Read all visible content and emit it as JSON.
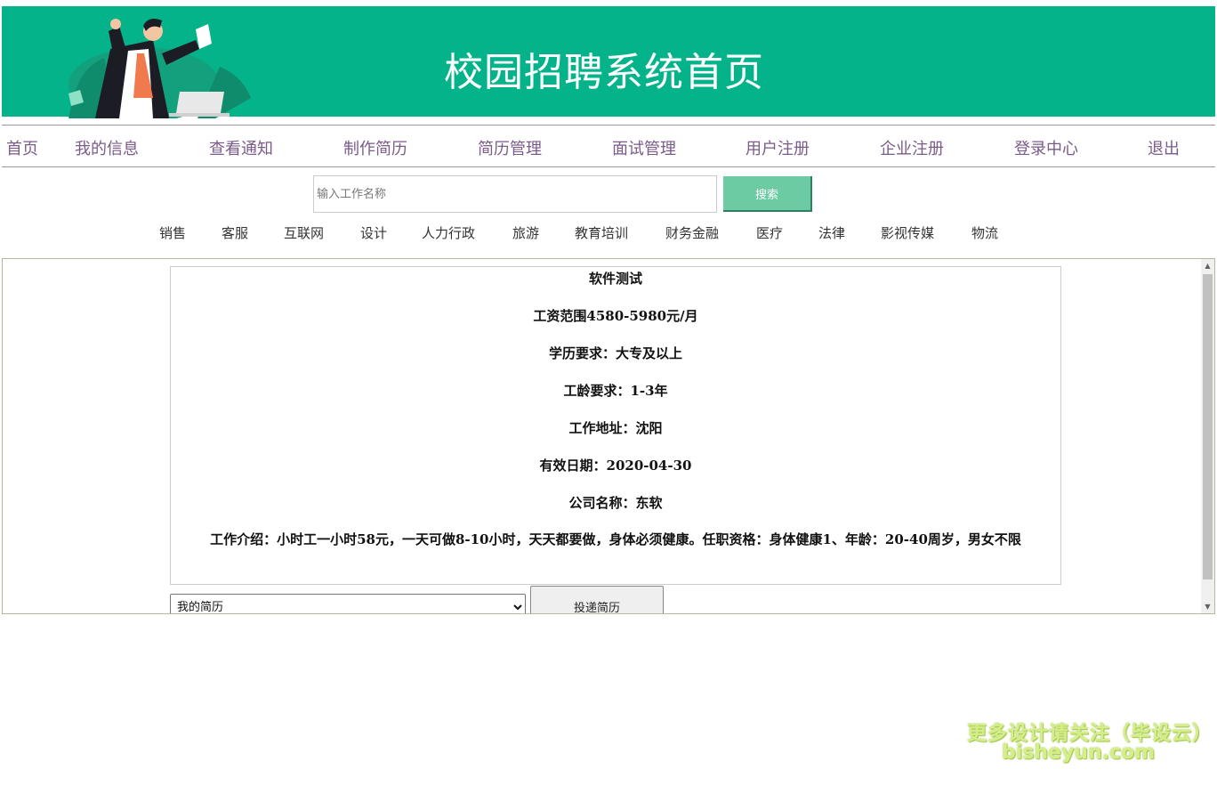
{
  "header": {
    "title": "校园招聘系统首页",
    "bg_color": "#05b38b",
    "illustration": "businessman-illustration"
  },
  "nav": {
    "items": [
      "首页",
      "我的信息",
      "查看通知",
      "制作简历",
      "简历管理",
      "面试管理",
      "用户注册",
      "企业注册",
      "登录中心",
      "退出"
    ]
  },
  "search": {
    "placeholder": "输入工作名称",
    "button_label": "搜索"
  },
  "categories": [
    "销售",
    "客服",
    "互联网",
    "设计",
    "人力行政",
    "旅游",
    "教育培训",
    "财务金融",
    "医疗",
    "法律",
    "影视传媒",
    "物流"
  ],
  "job": {
    "title": "软件测试",
    "salary": "工资范围4580-5980元/月",
    "education": "学历要求：大专及以上",
    "experience": "工龄要求：1-3年",
    "location": "工作地址：沈阳",
    "valid_date": "有效日期：2020-04-30",
    "company": "公司名称：东软",
    "intro": "工作介绍：小时工一小时58元，一天可做8-10小时，天天都要做，身体必须健康。任职资格：身体健康1、年龄：20-40周岁，男女不限"
  },
  "apply": {
    "resume_select_value": "我的简历",
    "submit_label": "投递简历"
  },
  "watermark": {
    "line1": "更多设计请关注（毕设云）",
    "line2": "bisheyun.com"
  }
}
